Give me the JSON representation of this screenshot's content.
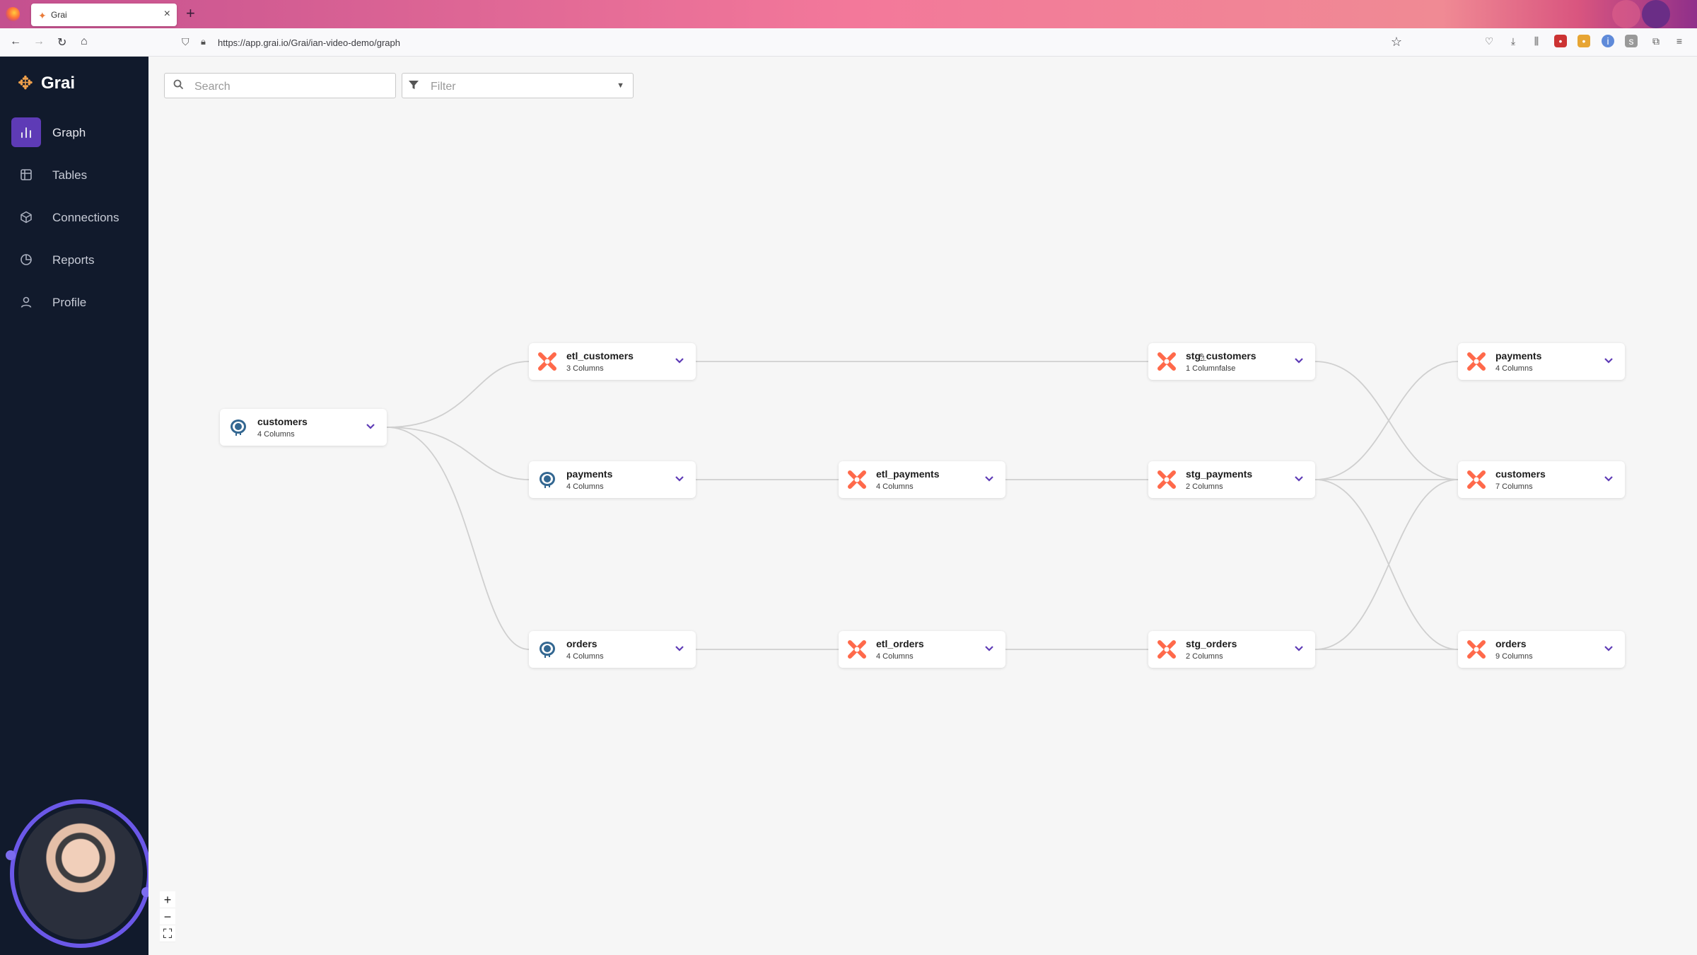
{
  "browser": {
    "tab_title": "Grai",
    "url": "https://app.grai.io/Grai/ian-video-demo/graph"
  },
  "app": {
    "name": "Grai"
  },
  "sidebar": {
    "items": [
      {
        "label": "Graph",
        "icon": "bar-chart-icon",
        "active": true
      },
      {
        "label": "Tables",
        "icon": "table-icon",
        "active": false
      },
      {
        "label": "Connections",
        "icon": "cube-icon",
        "active": false
      },
      {
        "label": "Reports",
        "icon": "pie-chart-icon",
        "active": false
      },
      {
        "label": "Profile",
        "icon": "user-icon",
        "active": false
      }
    ]
  },
  "toolbar": {
    "search_placeholder": "Search",
    "filter_placeholder": "Filter"
  },
  "graph": {
    "nodes": [
      {
        "id": "n1",
        "name": "customers",
        "columns": "4 Columns",
        "source": "postgres"
      },
      {
        "id": "n2",
        "name": "etl_customers",
        "columns": "3 Columns",
        "source": "dbt"
      },
      {
        "id": "n3",
        "name": "payments",
        "columns": "4 Columns",
        "source": "postgres"
      },
      {
        "id": "n4",
        "name": "orders",
        "columns": "4 Columns",
        "source": "postgres"
      },
      {
        "id": "n5",
        "name": "etl_payments",
        "columns": "4 Columns",
        "source": "dbt"
      },
      {
        "id": "n6",
        "name": "etl_orders",
        "columns": "4 Columns",
        "source": "dbt"
      },
      {
        "id": "n7",
        "name": "stg_customers",
        "columns": "1 Columnfalse",
        "source": "dbt"
      },
      {
        "id": "n8",
        "name": "stg_payments",
        "columns": "2 Columns",
        "source": "dbt"
      },
      {
        "id": "n9",
        "name": "stg_orders",
        "columns": "2 Columns",
        "source": "dbt"
      },
      {
        "id": "n10",
        "name": "payments",
        "columns": "4 Columns",
        "source": "dbt"
      },
      {
        "id": "n11",
        "name": "customers",
        "columns": "7 Columns",
        "source": "dbt"
      },
      {
        "id": "n12",
        "name": "orders",
        "columns": "9 Columns",
        "source": "dbt"
      }
    ]
  },
  "zoom_controls": {
    "zoom_in": "+",
    "zoom_out": "−",
    "fit": "⛶"
  },
  "colors": {
    "accent": "#5e3bb6",
    "sidebar_bg": "#111a2c",
    "dbt_orange": "#ff694a",
    "postgres_blue": "#336791"
  }
}
